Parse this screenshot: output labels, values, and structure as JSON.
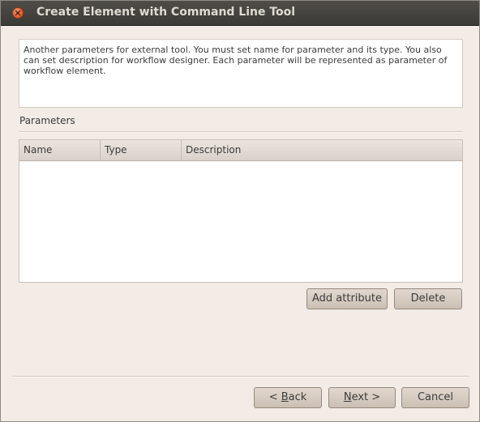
{
  "window": {
    "title": "Create Element with Command Line Tool"
  },
  "description": "Another parameters for external tool. You must set name for parameter and its type. You also can set description for workflow designer. Each parameter will be represented as parameter of workflow element.",
  "parameters": {
    "group_label": "Parameters",
    "columns": [
      "Name",
      "Type",
      "Description"
    ],
    "rows": []
  },
  "actions": {
    "add_attribute_label": "Add attribute",
    "delete_label": "Delete"
  },
  "footer": {
    "back_prefix": "< ",
    "back_mnemonic": "B",
    "back_rest": "ack",
    "next_mnemonic": "N",
    "next_rest": "ext >",
    "cancel_label": "Cancel"
  },
  "colors": {
    "titlebar": "#3b3a36",
    "dialog_bg": "#f2ebe6",
    "close_button": "#e05a2b"
  }
}
